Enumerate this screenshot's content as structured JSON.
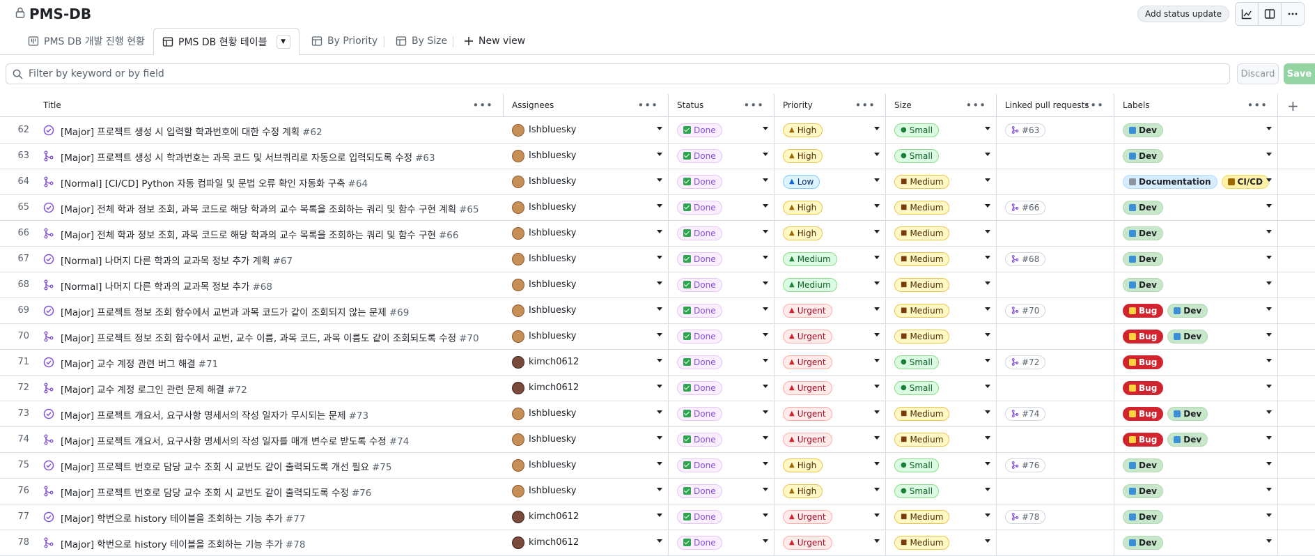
{
  "header": {
    "title": "PMS-DB",
    "status_update_label": "Add status update"
  },
  "tabs": [
    {
      "label": "PMS DB 개발 진행 현황"
    },
    {
      "label": "PMS DB 현황 테이블"
    },
    {
      "label": "By Priority"
    },
    {
      "label": "By Size"
    },
    {
      "label": "New view"
    }
  ],
  "filter": {
    "placeholder": "Filter by keyword or by field",
    "discard_label": "Discard",
    "save_label": "Save"
  },
  "columns": [
    "Title",
    "Assignees",
    "Status",
    "Priority",
    "Size",
    "Linked pull requests",
    "Labels"
  ],
  "rows": [
    {
      "num": "62",
      "type": "issue",
      "title": "[Major] 프로젝트 생성 시 입력할 학과번호에 대한 수정 계획",
      "issue": "#62",
      "assignee": "Ishbluesky",
      "status": "Done",
      "priority": "High",
      "size": "Small",
      "pr": "#63",
      "labels": [
        "Dev"
      ]
    },
    {
      "num": "63",
      "type": "pr",
      "title": "[Major] 프로젝트 생성 시 학과번호는 과목 코드 및 서브쿼리로 자동으로 입력되도록 수정",
      "issue": "#63",
      "assignee": "Ishbluesky",
      "status": "Done",
      "priority": "High",
      "size": "Small",
      "pr": "",
      "labels": [
        "Dev"
      ]
    },
    {
      "num": "64",
      "type": "pr",
      "title": "[Normal] [CI/CD] Python 자동 컴파일 및 문법 오류 확인 자동화 구축",
      "issue": "#64",
      "assignee": "Ishbluesky",
      "status": "Done",
      "priority": "Low",
      "size": "Medium",
      "pr": "",
      "labels": [
        "Documentation",
        "CI/CD"
      ]
    },
    {
      "num": "65",
      "type": "issue",
      "title": "[Major] 전체 학과 정보 조회, 과목 코드로 해당 학과의 교수 목록을 조회하는 쿼리 및 함수 구현 계획",
      "issue": "#65",
      "assignee": "Ishbluesky",
      "status": "Done",
      "priority": "High",
      "size": "Medium",
      "pr": "#66",
      "labels": [
        "Dev"
      ]
    },
    {
      "num": "66",
      "type": "pr",
      "title": "[Major] 전체 학과 정보 조회, 과목 코드로 해당 학과의 교수 목록을 조회하는 쿼리 및 함수 구현",
      "issue": "#66",
      "assignee": "Ishbluesky",
      "status": "Done",
      "priority": "High",
      "size": "Medium",
      "pr": "",
      "labels": [
        "Dev"
      ]
    },
    {
      "num": "67",
      "type": "issue",
      "title": "[Normal] 나머지 다른 학과의 교과목 정보 추가 계획",
      "issue": "#67",
      "assignee": "Ishbluesky",
      "status": "Done",
      "priority": "Medium",
      "size": "Medium",
      "pr": "#68",
      "labels": [
        "Dev"
      ]
    },
    {
      "num": "68",
      "type": "pr",
      "title": "[Normal] 나머지 다른 학과의 교과목 정보 추가",
      "issue": "#68",
      "assignee": "Ishbluesky",
      "status": "Done",
      "priority": "Medium",
      "size": "Medium",
      "pr": "",
      "labels": [
        "Dev"
      ]
    },
    {
      "num": "69",
      "type": "issue",
      "title": "[Major] 프로젝트 정보 조회 함수에서 교번과 과목 코드가 같이 조회되지 않는 문제",
      "issue": "#69",
      "assignee": "Ishbluesky",
      "status": "Done",
      "priority": "Urgent",
      "size": "Medium",
      "pr": "#70",
      "labels": [
        "Bug",
        "Dev"
      ]
    },
    {
      "num": "70",
      "type": "pr",
      "title": "[Major] 프로젝트 정보 조회 함수에서 교번, 교수 이름, 과목 코드, 과목 이름도 같이 조회되도록 수정",
      "issue": "#70",
      "assignee": "Ishbluesky",
      "status": "Done",
      "priority": "Urgent",
      "size": "Medium",
      "pr": "",
      "labels": [
        "Bug",
        "Dev"
      ]
    },
    {
      "num": "71",
      "type": "issue",
      "title": "[Major] 교수 계정 관련 버그 해결",
      "issue": "#71",
      "assignee": "kimch0612",
      "status": "Done",
      "priority": "Urgent",
      "size": "Small",
      "pr": "#72",
      "labels": [
        "Bug"
      ]
    },
    {
      "num": "72",
      "type": "pr",
      "title": "[Major] 교수 계정 로그인 관련 문제 해결",
      "issue": "#72",
      "assignee": "kimch0612",
      "status": "Done",
      "priority": "Urgent",
      "size": "Small",
      "pr": "",
      "labels": [
        "Bug"
      ]
    },
    {
      "num": "73",
      "type": "issue",
      "title": "[Major] 프로젝트 개요서, 요구사항 명세서의 작성 일자가 무시되는 문제",
      "issue": "#73",
      "assignee": "Ishbluesky",
      "status": "Done",
      "priority": "Urgent",
      "size": "Medium",
      "pr": "#74",
      "labels": [
        "Bug",
        "Dev"
      ]
    },
    {
      "num": "74",
      "type": "pr",
      "title": "[Major] 프로젝트 개요서, 요구사항 명세서의 작성 일자를 매개 변수로 받도록 수정",
      "issue": "#74",
      "assignee": "Ishbluesky",
      "status": "Done",
      "priority": "Urgent",
      "size": "Medium",
      "pr": "",
      "labels": [
        "Bug",
        "Dev"
      ]
    },
    {
      "num": "75",
      "type": "issue",
      "title": "[Major] 프로젝트 번호로 담당 교수 조회 시 교번도 같이 출력되도록 개선 필요",
      "issue": "#75",
      "assignee": "Ishbluesky",
      "status": "Done",
      "priority": "High",
      "size": "Small",
      "pr": "#76",
      "labels": [
        "Dev"
      ]
    },
    {
      "num": "76",
      "type": "pr",
      "title": "[Major] 프로젝트 번호로 담당 교수 조회 시 교번도 같이 출력되도록 수정",
      "issue": "#76",
      "assignee": "Ishbluesky",
      "status": "Done",
      "priority": "High",
      "size": "Small",
      "pr": "",
      "labels": [
        "Dev"
      ]
    },
    {
      "num": "77",
      "type": "issue",
      "title": "[Major] 학번으로 history 테이블을 조회하는 기능 추가",
      "issue": "#77",
      "assignee": "kimch0612",
      "status": "Done",
      "priority": "Urgent",
      "size": "Medium",
      "pr": "#78",
      "labels": [
        "Dev"
      ]
    },
    {
      "num": "78",
      "type": "pr",
      "title": "[Major] 학번으로 history 테이블을 조회하는 기능 추가",
      "issue": "#78",
      "assignee": "kimch0612",
      "status": "Done",
      "priority": "Urgent",
      "size": "Medium",
      "pr": "",
      "labels": [
        "Dev"
      ]
    }
  ]
}
